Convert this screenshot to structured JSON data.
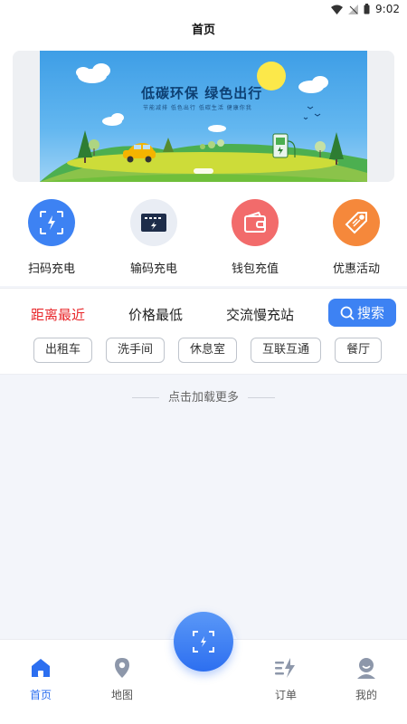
{
  "status_bar": {
    "time": "9:02"
  },
  "header": {
    "title": "首页"
  },
  "banner": {
    "title": "低碳环保  绿色出行",
    "subtitle": "节能减排  低色出行  低碳生活  健康你我"
  },
  "quick_actions": [
    {
      "label": "扫码充电",
      "icon": "scan-charge-icon",
      "color": "#3d82f3"
    },
    {
      "label": "输码充电",
      "icon": "code-charge-icon",
      "color": "#e9edf4"
    },
    {
      "label": "钱包充值",
      "icon": "wallet-icon",
      "color": "#f26b6b"
    },
    {
      "label": "优惠活动",
      "icon": "coupon-tag-icon",
      "color": "#f5883b"
    }
  ],
  "filters": {
    "tabs": [
      "距离最近",
      "价格最低",
      "交流慢充站"
    ],
    "search_label": "搜索",
    "tags": [
      "出租车",
      "洗手间",
      "休息室",
      "互联互通",
      "餐厅"
    ]
  },
  "list": {
    "load_more": "点击加载更多"
  },
  "bottom_nav": {
    "items": [
      {
        "label": "首页",
        "icon": "home-icon"
      },
      {
        "label": "地图",
        "icon": "map-pin-icon"
      },
      {
        "label": "订单",
        "icon": "order-icon"
      },
      {
        "label": "我的",
        "icon": "profile-icon"
      }
    ]
  },
  "colors": {
    "accent": "#3d82f3",
    "active_tab": "#e8272b"
  }
}
